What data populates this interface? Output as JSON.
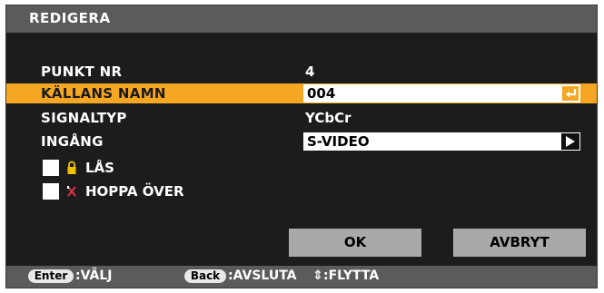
{
  "dialog": {
    "title": "REDIGERA"
  },
  "fields": {
    "item_number": {
      "label": "PUNKT NR",
      "value": "4"
    },
    "source_name": {
      "label": "KÄLLANS NAMN",
      "value": "004"
    },
    "signal_type": {
      "label": "SIGNALTYP",
      "value": "YCbCr"
    },
    "input": {
      "label": "INGÅNG",
      "value": "S-VIDEO"
    }
  },
  "options": {
    "lock": {
      "label": "LÅS",
      "checked": false,
      "icon": "lock-icon"
    },
    "skip": {
      "label": "HOPPA ÖVER",
      "checked": false,
      "icon": "skip-x-icon"
    }
  },
  "buttons": {
    "ok": "OK",
    "cancel": "AVBRYT"
  },
  "footer": {
    "enter_key": "Enter",
    "enter_action": ":VÄLJ",
    "back_key": "Back",
    "back_action": ":AVSLUTA",
    "move_glyph": "⇕",
    "move_action": ":FLYTTA"
  },
  "colors": {
    "highlight": "#f5a623",
    "panel": "#1c1c1c",
    "bar": "#5b5b5b",
    "button": "#a9a9a9"
  }
}
